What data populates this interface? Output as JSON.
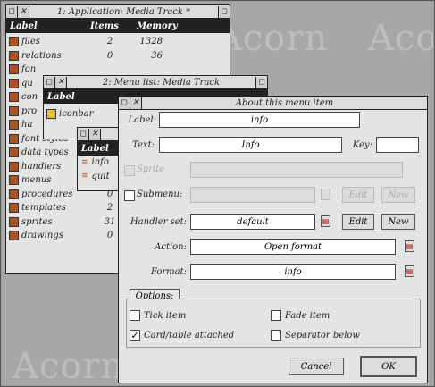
{
  "background_words": [
    "Acorn",
    "Acorn",
    "Acorn"
  ],
  "app_window": {
    "title": "1: Application: Media Track *",
    "headers": {
      "label": "Label",
      "items": "Items",
      "memory": "Memory"
    },
    "rows": [
      {
        "label": "files",
        "items": "2",
        "memory": "1328"
      },
      {
        "label": "relations",
        "items": "0",
        "memory": "36"
      },
      {
        "label": "fon",
        "items": "",
        "memory": ""
      },
      {
        "label": "qu",
        "items": "",
        "memory": ""
      },
      {
        "label": "con",
        "items": "",
        "memory": ""
      },
      {
        "label": "pro",
        "items": "",
        "memory": ""
      },
      {
        "label": "ha",
        "items": "",
        "memory": ""
      },
      {
        "label": "font styles",
        "items": "",
        "memory": ""
      },
      {
        "label": "data types",
        "items": "",
        "memory": ""
      },
      {
        "label": "handlers",
        "items": "",
        "memory": ""
      },
      {
        "label": "menus",
        "items": "1",
        "memory": ""
      },
      {
        "label": "procedures",
        "items": "0",
        "memory": ""
      },
      {
        "label": "templates",
        "items": "2",
        "memory": ""
      },
      {
        "label": "sprites",
        "items": "31",
        "memory": ""
      },
      {
        "label": "drawings",
        "items": "0",
        "memory": ""
      }
    ]
  },
  "menu_list": {
    "title": "2: Menu list: Media Track",
    "header": "Label",
    "row": "iconbar"
  },
  "menu3": {
    "header": "Label",
    "items": [
      "info",
      "quit"
    ]
  },
  "about": {
    "title": "About this menu item",
    "label_caption": "Label:",
    "label_value": "info",
    "text_caption": "Text:",
    "text_value": "Info",
    "key_caption": "Key:",
    "key_value": "",
    "sprite_caption": "Sprite",
    "submenu_caption": "Submenu:",
    "edit1": "Edit",
    "new1": "New",
    "handler_caption": "Handler set:",
    "handler_value": "default",
    "edit2": "Edit",
    "new2": "New",
    "action_caption": "Action:",
    "action_value": "Open format",
    "format_caption": "Format:",
    "format_value": "info",
    "options_label": "Options:",
    "tick_item": "Tick item",
    "fade_item": "Fade item",
    "card_table": "Card/table attached",
    "separator_below": "Separator below",
    "cancel": "Cancel",
    "ok": "OK"
  }
}
